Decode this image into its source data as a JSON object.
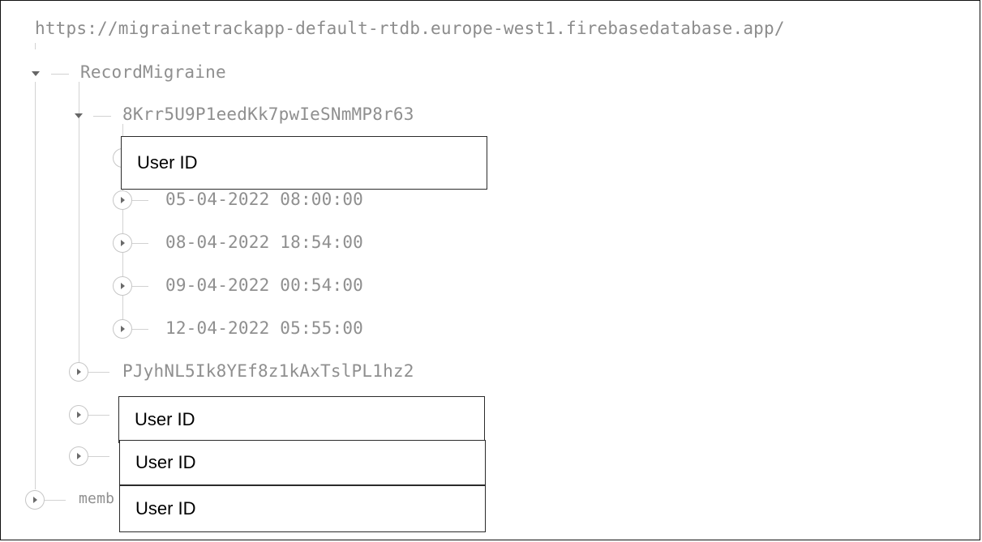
{
  "database_url": "https://migrainetrackapp-default-rtdb.europe-west1.firebasedatabase.app/",
  "tree": {
    "root": {
      "label": "RecordMigraine",
      "expanded": true,
      "users": [
        {
          "id": "8Krr5U9P1eedKk7pwIeSNmMP8r63",
          "expanded": true,
          "records": [
            {
              "label": "05-04-2022 08:00:00"
            },
            {
              "label": "08-04-2022 18:54:00"
            },
            {
              "label": "09-04-2022 00:54:00"
            },
            {
              "label": "12-04-2022 05:55:00"
            }
          ]
        },
        {
          "id": "PJyhNL5Ik8YEf8z1kAxTslPL1hz2",
          "expanded": false
        }
      ]
    },
    "second_root_partial": "memb"
  },
  "overlays": [
    {
      "text": "User ID"
    },
    {
      "text": "User ID"
    },
    {
      "text": "User ID"
    },
    {
      "text": "User ID"
    }
  ],
  "icons": {
    "expanded": "caret-down-icon",
    "collapsed": "expand-circle-icon"
  }
}
